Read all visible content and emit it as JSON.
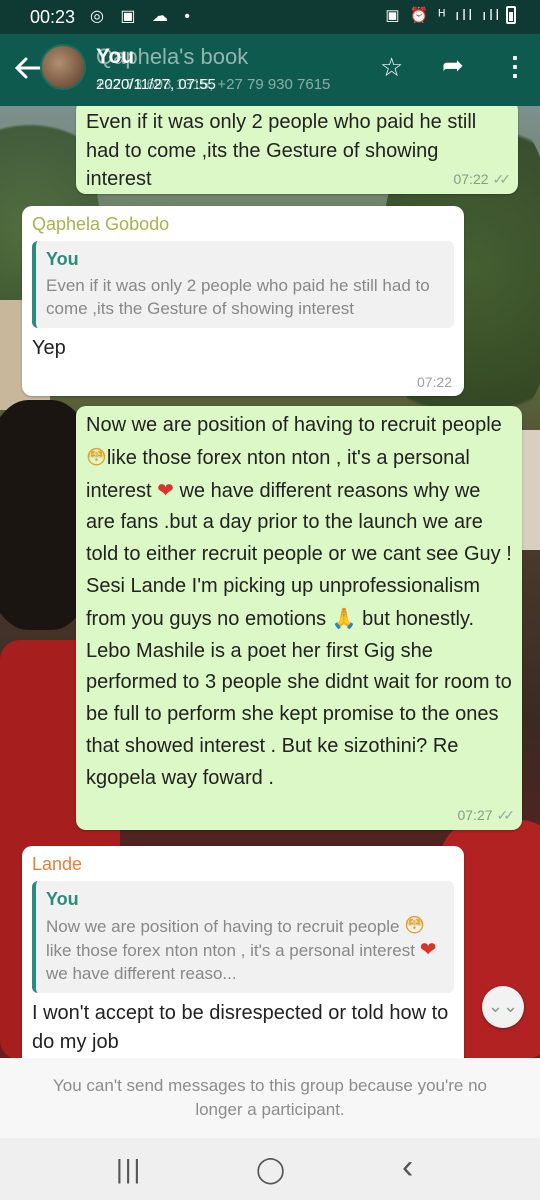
{
  "status_bar": {
    "time": "00:23",
    "left_icons": "◎ ▣ ☁ •",
    "right_icons": "▣ ⏰ ᴴ ıll ıll"
  },
  "header": {
    "back_icon": "back-arrow-icon",
    "underlying_title": "Qaphela's book",
    "title": "You",
    "underlying_subtitle": "+27 73 693 1315, +27 79 930 7615",
    "subtitle": "2020/11/27, 07:55",
    "star_icon": "☆",
    "share_icon": "➦",
    "more_icon": "⋮"
  },
  "messages": [
    {
      "type": "outgoing",
      "text": "Even if it was only 2 people who paid  he still had to come ,its the Gesture of showing interest",
      "time": "07:22",
      "ticks": "✓✓"
    },
    {
      "type": "incoming",
      "sender": "Qaphela Gobodo",
      "quote_author": "You",
      "quote_text": "Even if it was only 2 people who paid  he still had to come ,its the Gesture of showing interest",
      "text": "Yep",
      "time": "07:22"
    },
    {
      "type": "outgoing",
      "text_1": "Now we are position of having to recruit people ",
      "emoji_1": "😳",
      "text_2": "like those forex nton nton , it's a personal interest ",
      "emoji_2": "❤",
      "text_3": " we have different reasons why we are fans .but a day prior to the launch we are told to either recruit people or we cant see Guy ! Sesi Lande I'm picking up unprofessionalism from you guys no emotions ",
      "emoji_3": "🙏",
      "text_4": " but honestly. Lebo Mashile is a poet her first Gig she performed to 3 people she didnt wait for room to be full to perform she kept promise to the ones that showed interest . But ke sizothini? Re kgopela way foward .",
      "time": "07:27",
      "ticks": "✓✓"
    },
    {
      "type": "incoming",
      "sender": "Lande",
      "quote_author": "You",
      "quote_text_1": "Now we are position of having to recruit people ",
      "quote_emoji_1": "😳",
      "quote_text_2": "like those forex nton nton , it's a personal interest ",
      "quote_emoji_2": "❤",
      "quote_text_3": " we have different reaso...",
      "text": "I won't accept to be disrespected or told how to do my job"
    }
  ],
  "scroll_down_icon": "⌄⌄",
  "footer": {
    "notice": "You can't send messages to this group because you're no longer a participant."
  },
  "navbar": {
    "recents": "|||",
    "home": "◯",
    "back": "‹"
  },
  "colors": {
    "appbar": "#0f5a4e",
    "statusbar": "#0e3a33",
    "outgoing_bubble": "#dcf8c6",
    "incoming_bubble": "#ffffff",
    "quote_accent": "#2a8c7c"
  }
}
